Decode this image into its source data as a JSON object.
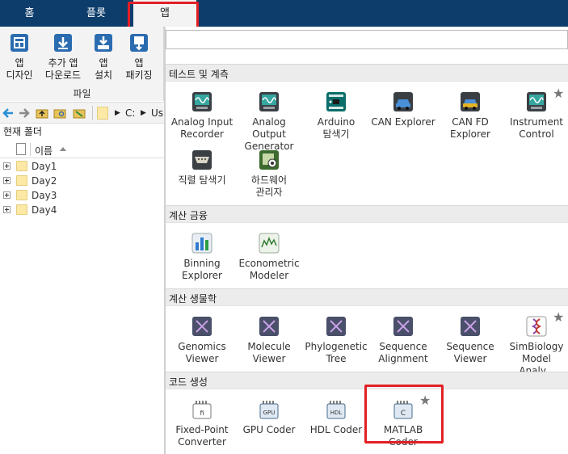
{
  "ribbon": {
    "tabs": [
      {
        "label": "홈"
      },
      {
        "label": "플롯"
      },
      {
        "label": "앱"
      }
    ]
  },
  "toolstrip": {
    "tools": [
      {
        "line1": "앱",
        "line2": "디자인",
        "icon": "app-designer-icon"
      },
      {
        "line1": "추가 앱",
        "line2": "다운로드",
        "icon": "get-more-apps-icon"
      },
      {
        "line1": "앱",
        "line2": "설치",
        "icon": "install-app-icon"
      },
      {
        "line1": "앱",
        "line2": "패키징",
        "icon": "package-app-icon"
      }
    ],
    "section_label": "파일"
  },
  "pathbar": {
    "path_drive": "C:",
    "path_rest": "Us"
  },
  "current_folder": {
    "title": "현재 폴더",
    "column_name": "이름",
    "items": [
      {
        "name": "Day1"
      },
      {
        "name": "Day2"
      },
      {
        "name": "Day3"
      },
      {
        "name": "Day4"
      }
    ]
  },
  "gallery": {
    "categories": [
      {
        "title": "테스트 및 계측",
        "apps": [
          {
            "line1": "Analog Input",
            "line2": "Recorder",
            "icon": "analog-input-recorder-icon"
          },
          {
            "line1": "Analog Output",
            "line2": "Generator",
            "icon": "analog-output-generator-icon"
          },
          {
            "line1": "Arduino",
            "line2": "탐색기",
            "icon": "arduino-explorer-icon"
          },
          {
            "line1": "CAN Explorer",
            "line2": "",
            "icon": "can-explorer-icon"
          },
          {
            "line1": "CAN FD",
            "line2": "Explorer",
            "icon": "can-fd-explorer-icon"
          },
          {
            "line1": "Instrument",
            "line2": "Control",
            "icon": "instrument-control-icon"
          },
          {
            "line1": "직렬 탐색기",
            "line2": "",
            "icon": "serial-explorer-icon"
          },
          {
            "line1": "하드웨어",
            "line2": "관리자",
            "icon": "hardware-manager-icon"
          }
        ]
      },
      {
        "title": "계산 금융",
        "apps": [
          {
            "line1": "Binning",
            "line2": "Explorer",
            "icon": "binning-explorer-icon"
          },
          {
            "line1": "Econometric",
            "line2": "Modeler",
            "icon": "econometric-modeler-icon"
          }
        ]
      },
      {
        "title": "계산 생물학",
        "apps": [
          {
            "line1": "Genomics",
            "line2": "Viewer",
            "icon": "genomics-viewer-icon"
          },
          {
            "line1": "Molecule",
            "line2": "Viewer",
            "icon": "molecule-viewer-icon"
          },
          {
            "line1": "Phylogenetic",
            "line2": "Tree",
            "icon": "phylogenetic-tree-icon"
          },
          {
            "line1": "Sequence",
            "line2": "Alignment",
            "icon": "sequence-alignment-icon"
          },
          {
            "line1": "Sequence",
            "line2": "Viewer",
            "icon": "sequence-viewer-icon"
          },
          {
            "line1": "SimBiology",
            "line2": "Model Analy...",
            "icon": "simbiology-model-analyzer-icon"
          }
        ]
      },
      {
        "title": "코드 생성",
        "apps": [
          {
            "line1": "Fixed-Point",
            "line2": "Converter",
            "icon": "fixed-point-converter-icon"
          },
          {
            "line1": "GPU Coder",
            "line2": "",
            "icon": "gpu-coder-icon"
          },
          {
            "line1": "HDL Coder",
            "line2": "",
            "icon": "hdl-coder-icon"
          },
          {
            "line1": "MATLAB Coder",
            "line2": "",
            "icon": "matlab-coder-icon"
          }
        ]
      }
    ]
  },
  "colors": {
    "ribbon_bg": "#0d3d6b",
    "highlight_red": "#e11f26",
    "icon_dark": "#3a3f44",
    "icon_teal": "#35a6a0"
  }
}
